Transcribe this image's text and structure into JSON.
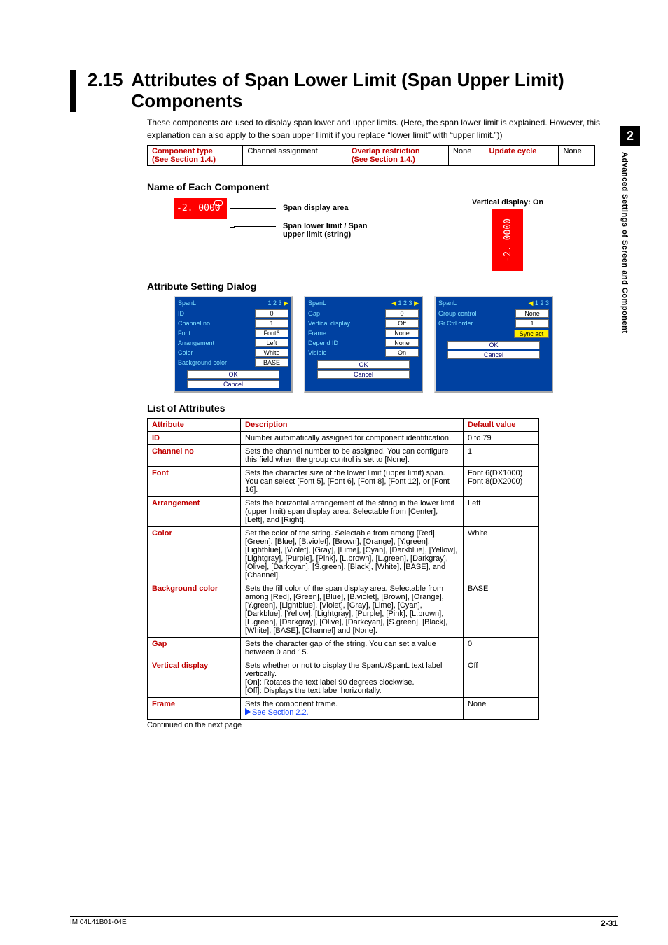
{
  "sidetab": {
    "num": "2",
    "text": "Advanced Settings of Screen and Component"
  },
  "section_number": "2.15",
  "section_title": "Attributes of Span Lower Limit (Span Upper Limit) Components",
  "intro": "These components are used to display span lower and upper limits.  (Here, the span lower limit is explained. However, this explanation can also apply to the span upper llimit if you replace “lower limit” with “upper limit.”))",
  "meta": {
    "h1": "Component type",
    "v1": "Channel assignment",
    "h2": "Overlap restriction",
    "v2": "None",
    "h3": "Update cycle",
    "v3": "None",
    "see": "(See Section 1.4.)"
  },
  "headings": {
    "comp": "Name of Each Component",
    "dlg": "Attribute Setting Dialog",
    "list": "List of Attributes"
  },
  "diagram": {
    "value": "-2. 0000",
    "label1": "Span display area",
    "label2": "Span lower limit / Span upper limit (string)",
    "vert_title": "Vertical display: On",
    "vert_value": "-2. 0000"
  },
  "dialogs": [
    {
      "title": "SpanL",
      "pager": "1 2 3 ▶",
      "rows": [
        {
          "k": "ID",
          "v": "0"
        },
        {
          "k": "Channel no",
          "v": "1"
        },
        {
          "k": "Font",
          "v": "Font6"
        },
        {
          "k": "Arrangement",
          "v": "Left"
        },
        {
          "k": "Color",
          "v": "White"
        },
        {
          "k": "Background color",
          "v": "BASE"
        }
      ],
      "ok": "OK",
      "cancel": "Cancel"
    },
    {
      "title": "SpanL",
      "pager": "◀ 1 2 3 ▶",
      "rows": [
        {
          "k": "Gap",
          "v": "0"
        },
        {
          "k": "Vertical display",
          "v": "Off"
        },
        {
          "k": "Frame",
          "v": "None"
        },
        {
          "k": "Depend ID",
          "v": "None"
        },
        {
          "k": "Visible",
          "v": "On"
        }
      ],
      "ok": "OK",
      "cancel": "Cancel"
    },
    {
      "title": "SpanL",
      "pager": "◀ 1 2 3",
      "rows": [
        {
          "k": "Group control",
          "v": "None"
        },
        {
          "k": "Gr.Ctrl order",
          "v": "1"
        }
      ],
      "sync": "Sync act",
      "ok": "OK",
      "cancel": "Cancel"
    }
  ],
  "table": {
    "headers": {
      "a": "Attribute",
      "d": "Description",
      "v": "Default value"
    },
    "rows": [
      {
        "a": "ID",
        "d": "Number automatically assigned for component identification.",
        "v": "0 to 79"
      },
      {
        "a": "Channel no",
        "d": "Sets the channel number to be assigned. You can configure this field when the group control is set to [None].",
        "v": "1"
      },
      {
        "a": "Font",
        "d": "Sets the character size of the lower limit (upper limit) span. You can select [Font 5], [Font 6], [Font 8], [Font 12], or [Font 16].",
        "v": "Font 6(DX1000) Font 8(DX2000)"
      },
      {
        "a": "Arrangement",
        "d": "Sets the horizontal arrangement of the string in the lower limit (upper limit) span display area.  Selectable from [Center], [Left], and [Right].",
        "v": "Left"
      },
      {
        "a": "Color",
        "d": "Set the color of the string. Selectable from among [Red], [Green], [Blue], [B.violet], [Brown], [Orange], [Y.green], [Lightblue], [Violet], [Gray], [Lime], [Cyan], [Darkblue], [Yellow], [Lightgray], [Purple], [Pink], [L.brown], [L.green], [Darkgray], [Olive], [Darkcyan], [S.green], [Black], [White], [BASE], and [Channel].",
        "v": "White"
      },
      {
        "a": "Background color",
        "d": "Sets the fill color of the span display area. Selectable from among [Red], [Green], [Blue], [B.violet], [Brown], [Orange], [Y.green], [Lightblue], [Violet], [Gray], [Lime], [Cyan], [Darkblue], [Yellow], [Lightgray], [Purple], [Pink], [L.brown], [L.green], [Darkgray], [Olive], [Darkcyan], [S.green], [Black], [White], [BASE], [Channel] and [None].",
        "v": "BASE"
      },
      {
        "a": "Gap",
        "d": "Sets the character gap of the string. You can set a value between 0 and 15.",
        "v": "0"
      },
      {
        "a": "Vertical display",
        "d": "Sets whether or not to display the SpanU/SpanL text label vertically.\n[On]: Rotates the text label 90 degrees clockwise.\n[Off]: Displays the text label horizontally.",
        "v": "Off"
      },
      {
        "a": "Frame",
        "d_prefix": "Sets the component frame.",
        "see": "See Section 2.2.",
        "v": "None"
      }
    ],
    "continued": "Continued on the next page"
  },
  "footer": {
    "left": "IM 04L41B01-04E",
    "right": "2-31"
  }
}
